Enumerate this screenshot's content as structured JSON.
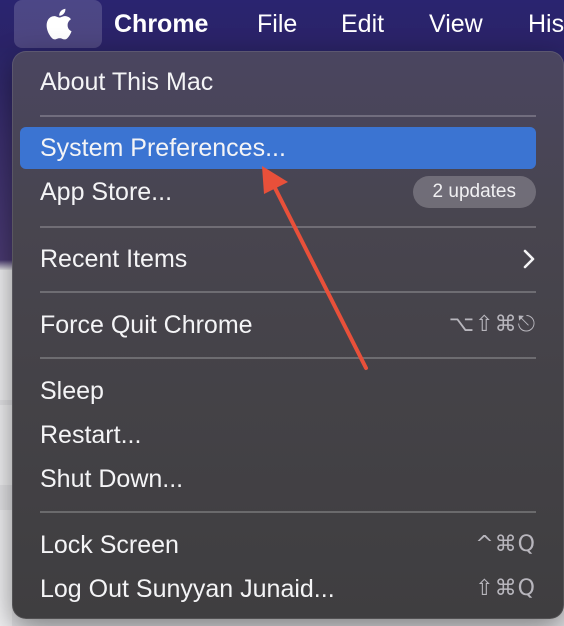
{
  "menubar": {
    "apple_icon": "apple-logo-icon",
    "app_name": "Chrome",
    "items": [
      "File",
      "Edit",
      "View",
      "His"
    ]
  },
  "apple_menu": {
    "about": "About This Mac",
    "system_preferences": "System Preferences...",
    "app_store": "App Store...",
    "app_store_badge": "2 updates",
    "recent_items": "Recent Items",
    "force_quit": "Force Quit Chrome",
    "force_quit_shortcut": "⌥⇧⌘⎋",
    "sleep": "Sleep",
    "restart": "Restart...",
    "shut_down": "Shut Down...",
    "lock_screen": "Lock Screen",
    "lock_screen_shortcut": "^⌘Q",
    "log_out": "Log Out Sunyyan Junaid...",
    "log_out_shortcut": "⇧⌘Q"
  },
  "colors": {
    "menubar_bg": "#2b2367",
    "highlight": "#3b74d2",
    "annotation_arrow": "#e8503a"
  }
}
